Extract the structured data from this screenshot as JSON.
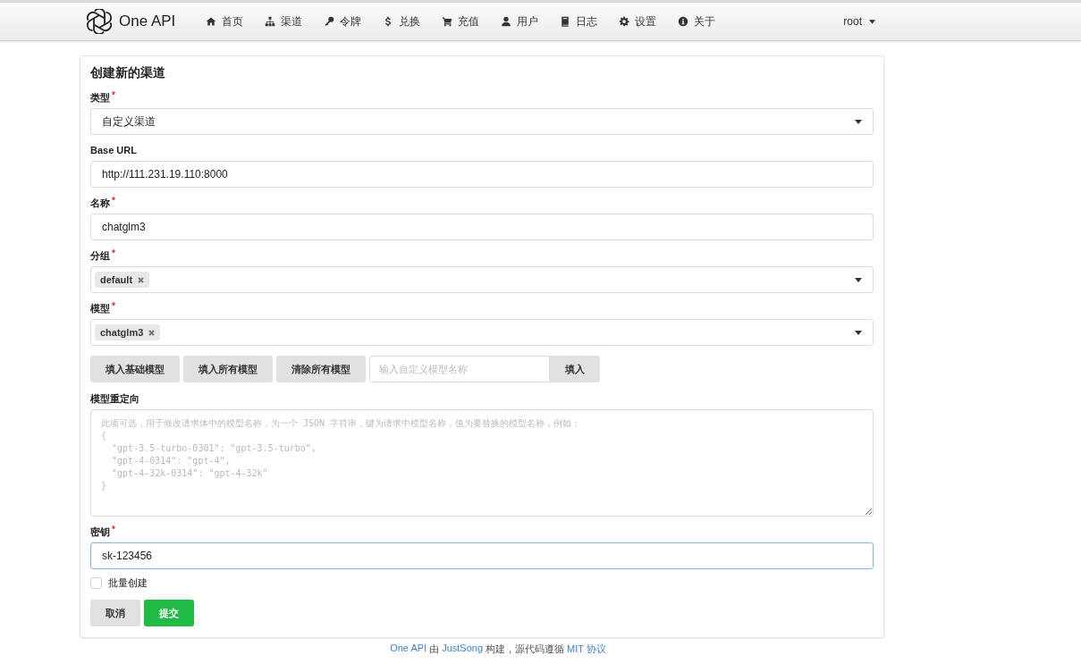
{
  "navbar": {
    "brand": "One API",
    "items": [
      {
        "label": "首页"
      },
      {
        "label": "渠道"
      },
      {
        "label": "令牌"
      },
      {
        "label": "兑换"
      },
      {
        "label": "充值"
      },
      {
        "label": "用户"
      },
      {
        "label": "日志"
      },
      {
        "label": "设置"
      },
      {
        "label": "关于"
      }
    ],
    "user": "root"
  },
  "form": {
    "title": "创建新的渠道",
    "fields": [
      {
        "kind": "select",
        "label": "类型",
        "mark": "*",
        "value": "自定义渠道"
      },
      {
        "kind": "input",
        "label": "Base URL",
        "value": "http://111.231.19.110:8000",
        "focused": false
      },
      {
        "kind": "input",
        "label": "名称",
        "mark": "*",
        "value": "chatglm3",
        "focused": false
      },
      {
        "kind": "tags",
        "label": "分组",
        "mark": "*",
        "tags": [
          "default"
        ]
      },
      {
        "kind": "tags",
        "label": "模型",
        "mark": "*",
        "tags": [
          "chatglm3"
        ]
      },
      {
        "kind": "actions",
        "buttons": [
          "填入基础模型",
          "填入所有模型",
          "清除所有模型"
        ],
        "placeholder": "输入自定义模型名称",
        "action": "填入"
      },
      {
        "kind": "textarea",
        "label": "模型重定向",
        "placeholder": "此项可选，用于修改请求体中的模型名称，为一个 JSON 字符串，键为请求中模型名称，值为要替换的模型名称，例如：\n{\n  \"gpt-3.5-turbo-0301\": \"gpt-3.5-turbo\",\n  \"gpt-4-0314\": \"gpt-4\",\n  \"gpt-4-32k-0314\": \"gpt-4-32k\"\n}"
      },
      {
        "kind": "input",
        "label": "密钥",
        "mark": "*",
        "value": "sk-123456",
        "focused": true
      }
    ],
    "batch": {
      "label": "批量创建",
      "checked": false
    },
    "buttons": [
      {
        "label": "取消",
        "kind": "secondary"
      },
      {
        "label": "提交",
        "kind": "primary"
      }
    ]
  },
  "footer": [
    {
      "text": "One API",
      "link": true
    },
    {
      "text": "由",
      "link": false
    },
    {
      "text": "JustSong",
      "link": true
    },
    {
      "text": "构建，源代码遵循",
      "link": false
    },
    {
      "text": "MIT 协议",
      "link": true
    }
  ]
}
